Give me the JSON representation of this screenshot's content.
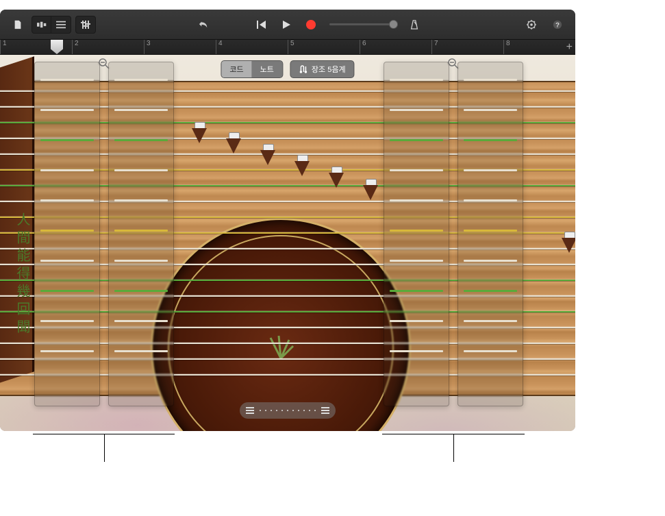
{
  "ruler": {
    "ticks": [
      "1",
      "2",
      "3",
      "4",
      "5",
      "6",
      "7",
      "8"
    ]
  },
  "mode": {
    "chord": "코드",
    "note": "노트"
  },
  "scale": {
    "label": "장조 5음계"
  },
  "characters": "人間能得幾回聞",
  "string_colors": {
    "green": "#5aaa3a",
    "yellow": "#d8b83a",
    "white": "#e8e0d0"
  },
  "zoom_panels": {
    "left_cols": 2,
    "right_cols": 2
  }
}
